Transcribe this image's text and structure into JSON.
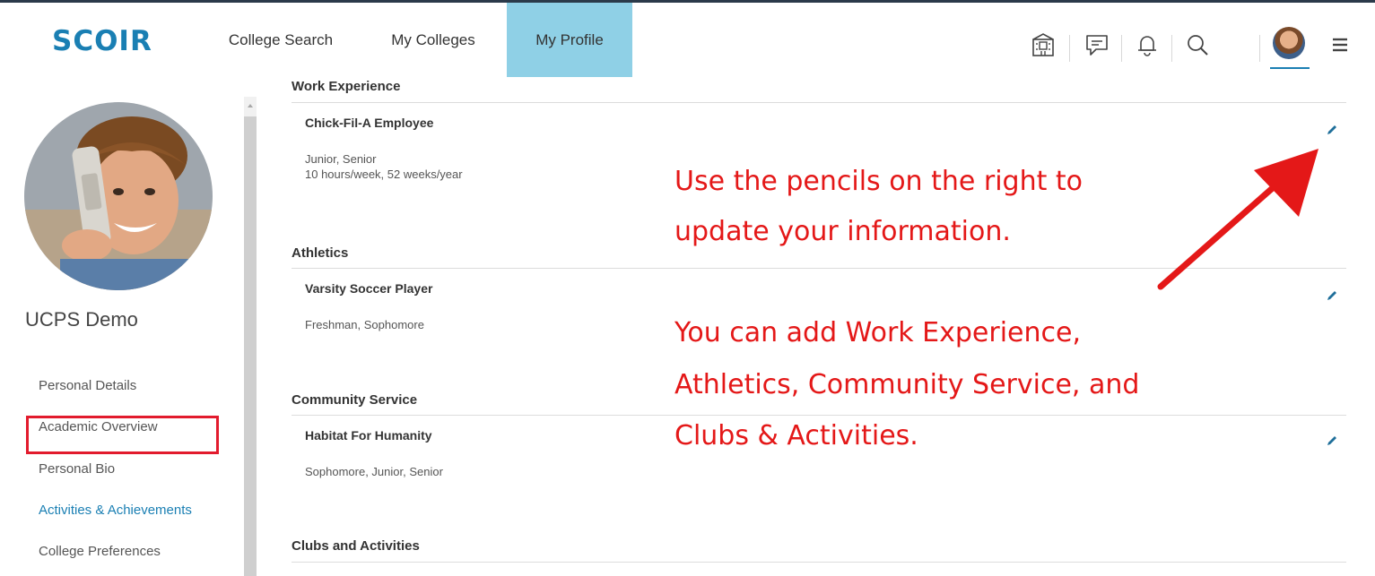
{
  "app": {
    "logo_text": "SCOIR"
  },
  "nav": {
    "college_search": "College Search",
    "my_colleges": "My Colleges",
    "my_profile": "My Profile"
  },
  "header_icons": [
    "building-icon",
    "chat-icon",
    "bell-icon",
    "search-icon",
    "user-avatar",
    "hamburger-menu-icon"
  ],
  "profile": {
    "name": "UCPS Demo"
  },
  "sidebar": {
    "items": [
      {
        "label": "Personal Details",
        "active": false
      },
      {
        "label": "Academic Overview",
        "active": false
      },
      {
        "label": "Personal Bio",
        "active": false
      },
      {
        "label": "Activities & Achievements",
        "active": true
      },
      {
        "label": "College Preferences",
        "active": false
      }
    ]
  },
  "sections": [
    {
      "title": "Work Experience",
      "entries": [
        {
          "title": "Chick-Fil-A Employee",
          "details": [
            "Junior, Senior",
            "10 hours/week, 52 weeks/year"
          ]
        }
      ]
    },
    {
      "title": "Athletics",
      "entries": [
        {
          "title": "Varsity Soccer Player",
          "details": [
            "Freshman, Sophomore"
          ]
        }
      ]
    },
    {
      "title": "Community Service",
      "entries": [
        {
          "title": "Habitat For Humanity",
          "details": [
            "Sophomore, Junior, Senior"
          ]
        }
      ]
    },
    {
      "title": "Clubs and Activities",
      "entries": []
    }
  ],
  "annotations": {
    "note1_line1": "Use the pencils on the right to",
    "note1_line2": "update your information.",
    "note2_line1": "You can add Work Experience,",
    "note2_line2": "Athletics, Community Service, and",
    "note2_line3": "Clubs & Activities."
  },
  "colors": {
    "brand": "#1a7fb3",
    "nav_active_bg": "#8fd0e6",
    "annotation_red": "#e41818",
    "highlight_box": "#e21b2d"
  }
}
